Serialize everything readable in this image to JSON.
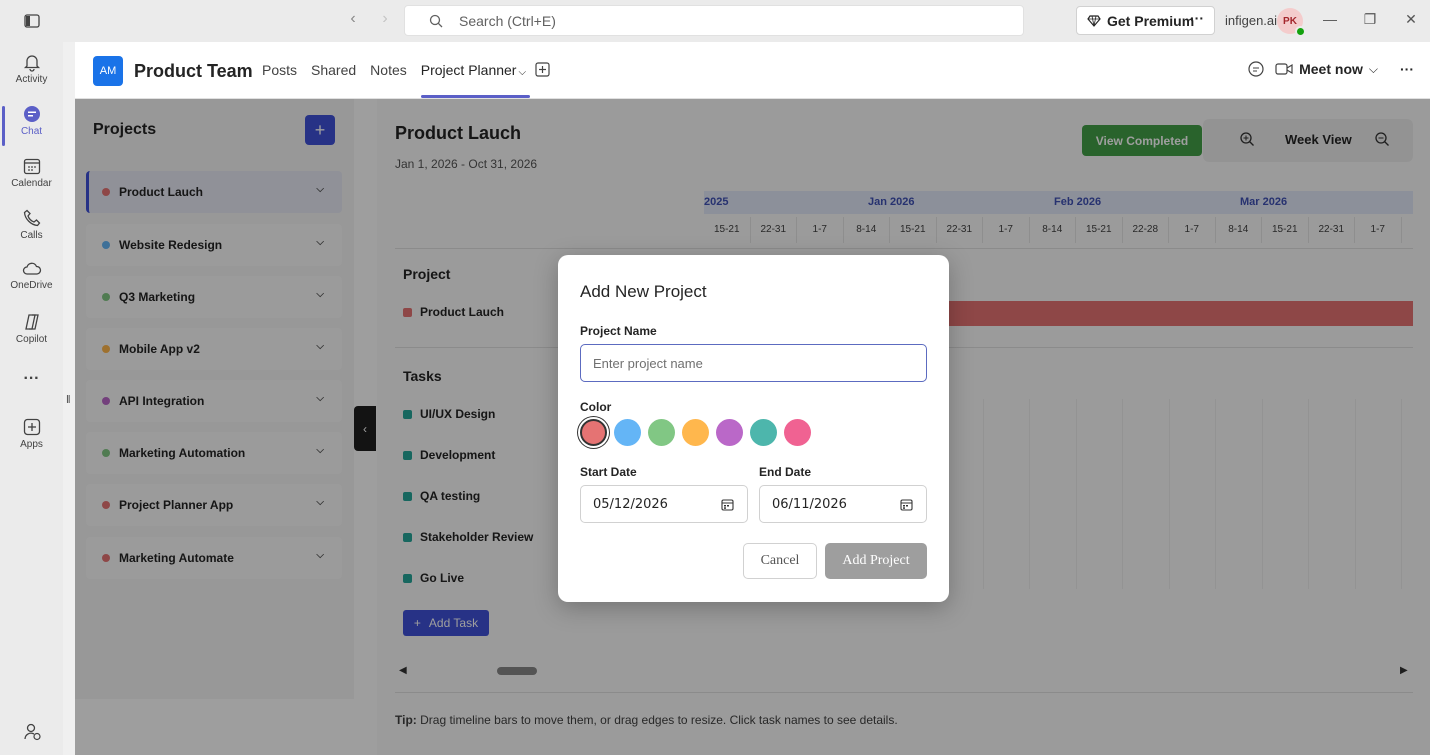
{
  "titlebar": {
    "search_placeholder": "Search (Ctrl+E)",
    "premium_label": "Get Premium",
    "more_label": "···",
    "org_name": "infigen.ai",
    "user_initials": "PK"
  },
  "rail": {
    "items": [
      {
        "label": "Activity",
        "icon": "bell-icon"
      },
      {
        "label": "Chat",
        "icon": "chat-icon"
      },
      {
        "label": "Calendar",
        "icon": "calendar-icon"
      },
      {
        "label": "Calls",
        "icon": "phone-icon"
      },
      {
        "label": "OneDrive",
        "icon": "cloud-icon"
      },
      {
        "label": "Copilot",
        "icon": "copilot-icon"
      },
      {
        "label": "Apps",
        "icon": "apps-icon"
      }
    ],
    "more": "···"
  },
  "header": {
    "team_initials": "AM",
    "team_name": "Product Team",
    "tabs": [
      "Posts",
      "Shared",
      "Notes",
      "Project Planner"
    ],
    "meet_label": "Meet now"
  },
  "projects_panel": {
    "title": "Projects",
    "add_label": "+",
    "items": [
      {
        "name": "Product Lauch",
        "color": "#e57373"
      },
      {
        "name": "Website Redesign",
        "color": "#64b5f6"
      },
      {
        "name": "Q3 Marketing",
        "color": "#81c784"
      },
      {
        "name": "Mobile App v2",
        "color": "#ffb74d"
      },
      {
        "name": "API Integration",
        "color": "#ba68c8"
      },
      {
        "name": "Marketing Automation",
        "color": "#81c784"
      },
      {
        "name": "Project Planner App",
        "color": "#e57373"
      },
      {
        "name": "Marketing Automate",
        "color": "#e57373"
      }
    ]
  },
  "gantt": {
    "title": "Product Lauch",
    "range": "Jan 1, 2026 - Oct 31, 2026",
    "view_completed": "View Completed",
    "view_mode": "Week View",
    "months": [
      "2025",
      "Jan 2026",
      "Feb 2026",
      "Mar 2026"
    ],
    "weeks": [
      "15-21",
      "22-31",
      "1-7",
      "8-14",
      "15-21",
      "22-31",
      "1-7",
      "8-14",
      "15-21",
      "22-28",
      "1-7",
      "8-14",
      "15-21",
      "22-31",
      "1-7"
    ],
    "project_section": "Project",
    "project_row": "Product Lauch",
    "tasks_section": "Tasks",
    "tasks": [
      "UI/UX Design",
      "Development",
      "QA testing",
      "Stakeholder Review",
      "Go Live"
    ],
    "add_task": "Add Task",
    "tip_label": "Tip:",
    "tip_text": " Drag timeline bars to move them, or drag edges to resize. Click task names to see details."
  },
  "modal": {
    "title": "Add New Project",
    "name_label": "Project Name",
    "name_placeholder": "Enter project name",
    "color_label": "Color",
    "colors": [
      "#e57373",
      "#64b5f6",
      "#81c784",
      "#ffb74d",
      "#ba68c8",
      "#4db6ac",
      "#f06292"
    ],
    "start_label": "Start Date",
    "start_value": "05/12/2026",
    "end_label": "End Date",
    "end_value": "06/11/2026",
    "cancel": "Cancel",
    "add": "Add Project"
  }
}
